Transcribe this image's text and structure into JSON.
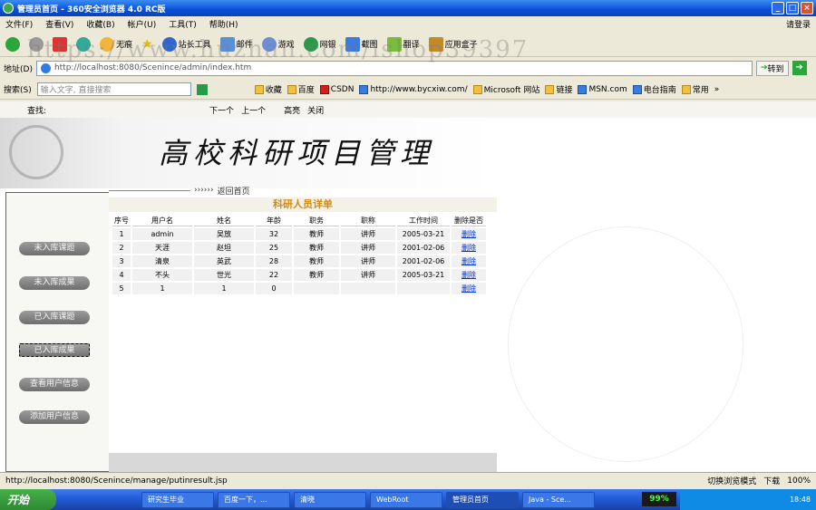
{
  "window": {
    "title": "管理员首页 - 360安全浏览器 4.0 RC版"
  },
  "menu": [
    "文件(F)",
    "查看(V)",
    "收藏(B)",
    "帐户(U)",
    "工具(T)",
    "帮助(H)"
  ],
  "login": "请登录",
  "toolbar": {
    "items": [
      "无痕",
      "站长工具",
      "邮件",
      "游戏",
      "网银",
      "截图",
      "翻译",
      "应用盒子"
    ]
  },
  "address": {
    "label": "地址(D)",
    "url": "http://localhost:8080/Scenince/admin/index.htm",
    "go": "转到"
  },
  "favbar": {
    "search_label": "搜索(S)",
    "search_placeholder": "输入文字, 直接搜索",
    "favorites": "收藏",
    "links": [
      "百度",
      "CSDN",
      "http://www.bycxiw.com/",
      "Microsoft 网站",
      "链接",
      "MSN.com",
      "电台指南",
      "常用"
    ],
    "more": "»"
  },
  "findbar": {
    "label": "查找:",
    "next": "下一个",
    "prev": "上一个",
    "highlight": "高亮",
    "close": "关闭"
  },
  "banner": {
    "title": "高校科研项目管理"
  },
  "breadcrumb": {
    "arrows": "››››››",
    "text": "返回首页"
  },
  "sidebar": {
    "items": [
      "未入库课题",
      "未入库成果",
      "已入库课题",
      "已入库成果",
      "查看用户信息",
      "添加用户信息"
    ]
  },
  "table": {
    "title": "科研人员详单",
    "headers": [
      "序号",
      "用户名",
      "姓名",
      "年龄",
      "职务",
      "职称",
      "工作时间",
      "删除是否"
    ],
    "rows": [
      [
        "1",
        "admin",
        "吴放",
        "32",
        "教师",
        "讲师",
        "2005-03-21",
        "删除"
      ],
      [
        "2",
        "天涯",
        "赵坦",
        "25",
        "教师",
        "讲师",
        "2001-02-06",
        "删除"
      ],
      [
        "3",
        "清泉",
        "英武",
        "28",
        "教师",
        "讲师",
        "2001-02-06",
        "删除"
      ],
      [
        "4",
        "不头",
        "世光",
        "22",
        "教师",
        "讲师",
        "2005-03-21",
        "删除"
      ],
      [
        "5",
        "1",
        "1",
        "0",
        "",
        "",
        "",
        "删除"
      ]
    ]
  },
  "status": {
    "url": "http://localhost:8080/Scenince/manage/putinresult.jsp",
    "mode": "切换浏览模式",
    "download": "下载",
    "zoom": "100%"
  },
  "taskbar": {
    "start": "开始",
    "tasks": [
      "研究生毕业",
      "百度一下，...",
      "清晓",
      "WebRoot",
      "管理员首页",
      "Java - Sce..."
    ],
    "meter": "99%",
    "clock": "18:48"
  },
  "watermark": "https://www.huzhan.com/ishop39397"
}
